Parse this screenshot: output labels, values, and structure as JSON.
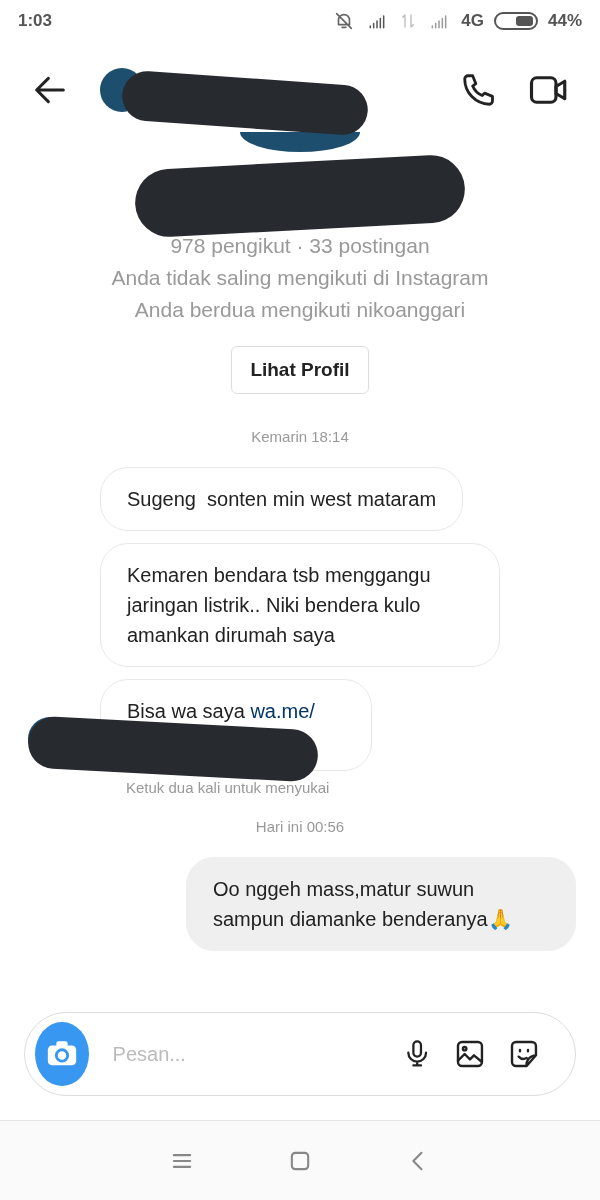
{
  "status_bar": {
    "time": "1:03",
    "network": "4G",
    "battery": "44%"
  },
  "profile": {
    "stats": "978 pengikut · 33 postingan",
    "lines": [
      "Anda tidak saling mengikuti di Instagram",
      "Anda berdua mengikuti nikoanggari"
    ],
    "button": "Lihat Profil"
  },
  "messages": [
    {
      "kind": "time",
      "text": "Kemarin 18:14"
    },
    {
      "kind": "received",
      "text": "Sugeng  sonten min west mataram"
    },
    {
      "kind": "received",
      "text": "Kemaren bendara tsb menggangu jaringan listrik.. Niki bendera kulo amankan dirumah saya"
    },
    {
      "kind": "received_link",
      "text": "Bisa wa saya",
      "link": "wa.me/"
    },
    {
      "kind": "hint",
      "text": "Ketuk dua kali untuk menyukai"
    },
    {
      "kind": "time",
      "text": "Hari ini 00:56"
    },
    {
      "kind": "sent",
      "text": "Oo nggeh mass,matur suwun sampun diamanke benderanya🙏"
    }
  ],
  "composer": {
    "placeholder": "Pesan..."
  }
}
